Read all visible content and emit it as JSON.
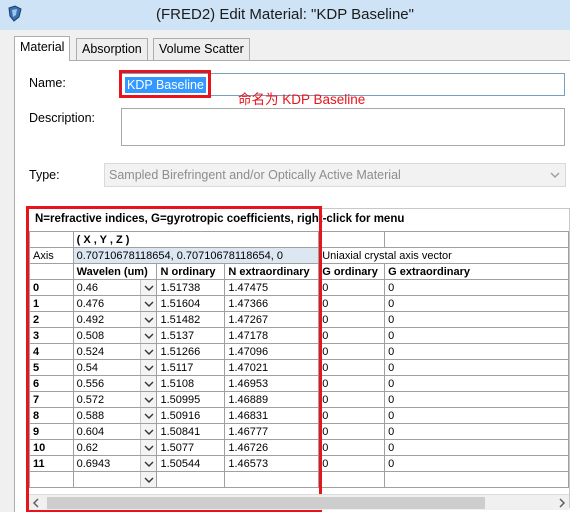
{
  "window": {
    "title": "(FRED2) Edit Material: \"KDP Baseline\""
  },
  "tabs": [
    {
      "label": "Material",
      "active": true
    },
    {
      "label": "Absorption",
      "active": false
    },
    {
      "label": "Volume Scatter",
      "active": false
    }
  ],
  "form": {
    "name_label": "Name:",
    "name_value": "KDP Baseline",
    "annotation": "命名为 KDP Baseline",
    "description_label": "Description:",
    "description_value": "",
    "type_label": "Type:",
    "type_value": "Sampled Birefringent and/or Optically Active Material"
  },
  "grid": {
    "header_text": "N=refractive indices,  G=gyrotropic coefficients,  right-click for menu",
    "xyz_label": "( X , Y , Z )",
    "axis_label": "Axis",
    "axis_value": "0.70710678118654,  0.70710678118654,  0",
    "axis_note": "Uniaxial crystal axis vector",
    "columns": [
      "Wavelen (um)",
      "N ordinary",
      "N extraordinary",
      "G ordinary",
      "G extraordinary"
    ],
    "rows": [
      {
        "idx": "0",
        "wav": "0.46",
        "no": "1.51738",
        "ne": "1.47475",
        "go": "0",
        "ge": "0"
      },
      {
        "idx": "1",
        "wav": "0.476",
        "no": "1.51604",
        "ne": "1.47366",
        "go": "0",
        "ge": "0"
      },
      {
        "idx": "2",
        "wav": "0.492",
        "no": "1.51482",
        "ne": "1.47267",
        "go": "0",
        "ge": "0"
      },
      {
        "idx": "3",
        "wav": "0.508",
        "no": "1.5137",
        "ne": "1.47178",
        "go": "0",
        "ge": "0"
      },
      {
        "idx": "4",
        "wav": "0.524",
        "no": "1.51266",
        "ne": "1.47096",
        "go": "0",
        "ge": "0"
      },
      {
        "idx": "5",
        "wav": "0.54",
        "no": "1.5117",
        "ne": "1.47021",
        "go": "0",
        "ge": "0"
      },
      {
        "idx": "6",
        "wav": "0.556",
        "no": "1.5108",
        "ne": "1.46953",
        "go": "0",
        "ge": "0"
      },
      {
        "idx": "7",
        "wav": "0.572",
        "no": "1.50995",
        "ne": "1.46889",
        "go": "0",
        "ge": "0"
      },
      {
        "idx": "8",
        "wav": "0.588",
        "no": "1.50916",
        "ne": "1.46831",
        "go": "0",
        "ge": "0"
      },
      {
        "idx": "9",
        "wav": "0.604",
        "no": "1.50841",
        "ne": "1.46777",
        "go": "0",
        "ge": "0"
      },
      {
        "idx": "10",
        "wav": "0.62",
        "no": "1.5077",
        "ne": "1.46726",
        "go": "0",
        "ge": "0"
      },
      {
        "idx": "11",
        "wav": "0.6943",
        "no": "1.50544",
        "ne": "1.46573",
        "go": "0",
        "ge": "0"
      }
    ]
  },
  "icons": {
    "app": "fred-app-icon",
    "dropdown": "chevron-down-icon",
    "scroll_left": "scroll-left-arrow-icon",
    "scroll_right": "scroll-right-arrow-icon"
  },
  "colors": {
    "highlight_red": "#e8141b",
    "selection_blue": "#3399ff",
    "titlebar": "#cfe3f6"
  }
}
